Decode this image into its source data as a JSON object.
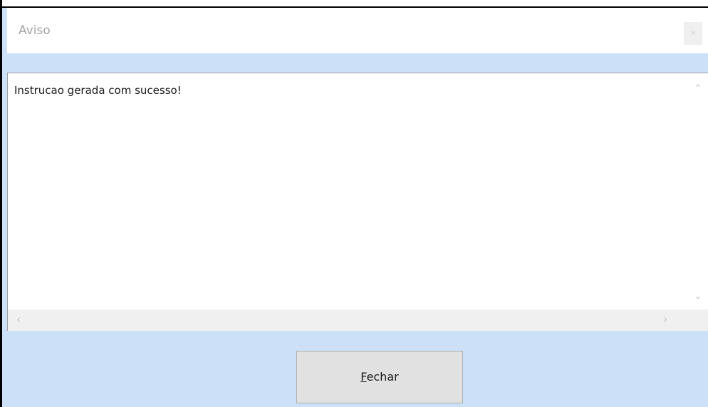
{
  "window": {
    "title": "Aviso",
    "close_glyph": "×"
  },
  "message": {
    "text": "Instrucao gerada com sucesso!"
  },
  "scrollbars": {
    "up_icon": "chevron-up-icon",
    "down_icon": "chevron-down-icon",
    "left_icon": "chevron-left-icon",
    "right_icon": "chevron-right-icon"
  },
  "footer": {
    "close_button": {
      "mnemonic": "F",
      "rest": "echar"
    }
  },
  "colors": {
    "panel_blue": "#cce0f8",
    "button_face": "#e1e1e1"
  }
}
